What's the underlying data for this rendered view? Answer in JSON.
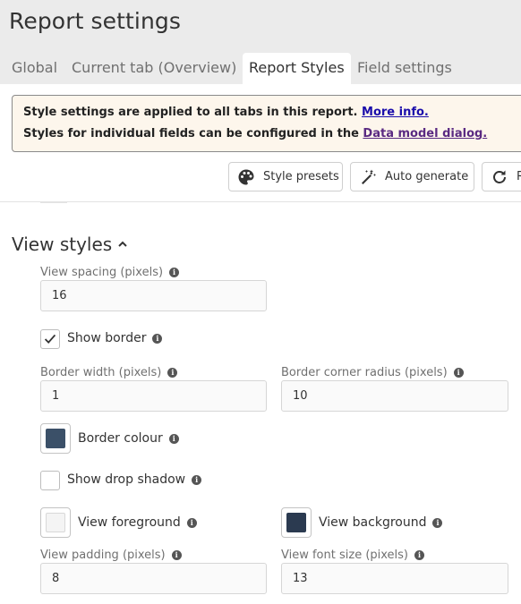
{
  "header": {
    "title": "Report settings",
    "tabs": [
      {
        "label": "Global",
        "active": false
      },
      {
        "label": "Current tab (Overview)",
        "active": false
      },
      {
        "label": "Report Styles",
        "active": true
      },
      {
        "label": "Field settings",
        "active": false
      }
    ]
  },
  "info": {
    "line1_text": "Style settings are applied to all tabs in this report.",
    "line1_link": "More info.",
    "line2_text": "Styles for individual fields can be configured in the",
    "line2_link": "Data model dialog."
  },
  "toolbar": {
    "style_presets": "Style presets",
    "auto_generate": "Auto generate",
    "reset": "R"
  },
  "view_styles": {
    "title": "View styles",
    "view_spacing": {
      "label": "View spacing (pixels)",
      "value": "16"
    },
    "show_border": {
      "label": "Show border",
      "checked": true
    },
    "border_width": {
      "label": "Border width (pixels)",
      "value": "1"
    },
    "border_radius": {
      "label": "Border corner radius (pixels)",
      "value": "10"
    },
    "border_colour": {
      "label": "Border colour",
      "color": "#3b5068"
    },
    "show_drop_shadow": {
      "label": "Show drop shadow",
      "checked": false
    },
    "view_foreground": {
      "label": "View foreground",
      "color": "#f4f4f4"
    },
    "view_background": {
      "label": "View background",
      "color": "#2b3a50"
    },
    "view_padding": {
      "label": "View padding (pixels)",
      "value": "8"
    },
    "view_font_size": {
      "label": "View font size (pixels)",
      "value": "13"
    }
  },
  "icons": {
    "info": "i"
  }
}
